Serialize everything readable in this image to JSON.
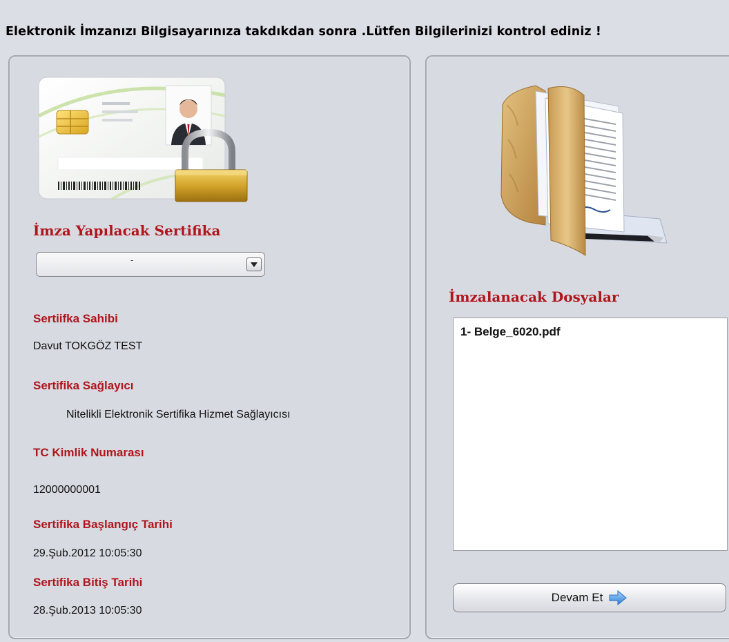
{
  "header": {
    "instruction": "Elektronik İmzanızı Bilgisayarınıza takdıkdan sonra .Lütfen Bilgilerinizi kontrol ediniz !"
  },
  "left_panel": {
    "certificate_label": "İmza Yapılacak Sertifika",
    "certificate_select_value": "-",
    "fields": [
      {
        "label": "Sertiifka Sahibi",
        "value": "Davut TOKGÖZ TEST"
      },
      {
        "label": "Sertifika Sağlayıcı",
        "value": "Nitelikli Elektronik Sertifika Hizmet Sağlayıcısı"
      },
      {
        "label": "TC Kimlik Numarası",
        "value": "12000000001"
      },
      {
        "label": "Sertifika Başlangıç Tarihi",
        "value": "29.Şub.2012 10:05:30"
      },
      {
        "label": "Sertifika Bitiş Tarihi",
        "value": "28.Şub.2013 10:05:30"
      }
    ]
  },
  "right_panel": {
    "files_label": "İmzalanacak Dosyalar",
    "files": [
      "1- Belge_6020.pdf"
    ],
    "continue_button_label": "Devam Et"
  },
  "icons": {
    "id_card": "id-card-lock-icon",
    "folder": "document-folder-icon",
    "arrow": "arrow-right-icon"
  },
  "colors": {
    "accent_red": "#b0151b",
    "background": "#dcdee6"
  }
}
